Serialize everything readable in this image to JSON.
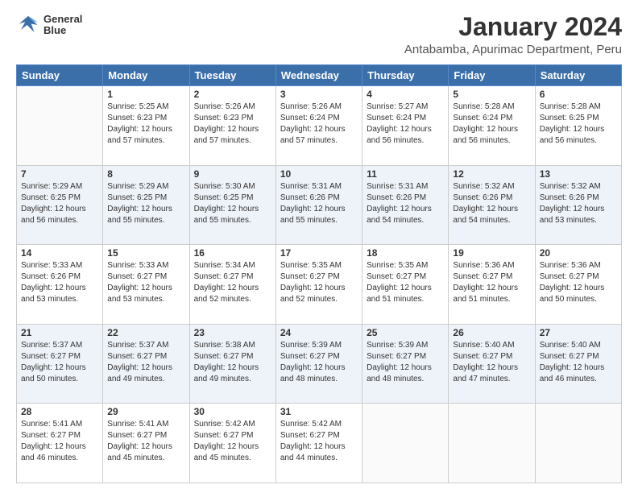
{
  "logo": {
    "line1": "General",
    "line2": "Blue"
  },
  "title": "January 2024",
  "subtitle": "Antabamba, Apurimac Department, Peru",
  "headers": [
    "Sunday",
    "Monday",
    "Tuesday",
    "Wednesday",
    "Thursday",
    "Friday",
    "Saturday"
  ],
  "weeks": [
    [
      {
        "day": "",
        "sunrise": "",
        "sunset": "",
        "daylight": ""
      },
      {
        "day": "1",
        "sunrise": "Sunrise: 5:25 AM",
        "sunset": "Sunset: 6:23 PM",
        "daylight": "Daylight: 12 hours and 57 minutes."
      },
      {
        "day": "2",
        "sunrise": "Sunrise: 5:26 AM",
        "sunset": "Sunset: 6:23 PM",
        "daylight": "Daylight: 12 hours and 57 minutes."
      },
      {
        "day": "3",
        "sunrise": "Sunrise: 5:26 AM",
        "sunset": "Sunset: 6:24 PM",
        "daylight": "Daylight: 12 hours and 57 minutes."
      },
      {
        "day": "4",
        "sunrise": "Sunrise: 5:27 AM",
        "sunset": "Sunset: 6:24 PM",
        "daylight": "Daylight: 12 hours and 56 minutes."
      },
      {
        "day": "5",
        "sunrise": "Sunrise: 5:28 AM",
        "sunset": "Sunset: 6:24 PM",
        "daylight": "Daylight: 12 hours and 56 minutes."
      },
      {
        "day": "6",
        "sunrise": "Sunrise: 5:28 AM",
        "sunset": "Sunset: 6:25 PM",
        "daylight": "Daylight: 12 hours and 56 minutes."
      }
    ],
    [
      {
        "day": "7",
        "sunrise": "Sunrise: 5:29 AM",
        "sunset": "Sunset: 6:25 PM",
        "daylight": "Daylight: 12 hours and 56 minutes."
      },
      {
        "day": "8",
        "sunrise": "Sunrise: 5:29 AM",
        "sunset": "Sunset: 6:25 PM",
        "daylight": "Daylight: 12 hours and 55 minutes."
      },
      {
        "day": "9",
        "sunrise": "Sunrise: 5:30 AM",
        "sunset": "Sunset: 6:25 PM",
        "daylight": "Daylight: 12 hours and 55 minutes."
      },
      {
        "day": "10",
        "sunrise": "Sunrise: 5:31 AM",
        "sunset": "Sunset: 6:26 PM",
        "daylight": "Daylight: 12 hours and 55 minutes."
      },
      {
        "day": "11",
        "sunrise": "Sunrise: 5:31 AM",
        "sunset": "Sunset: 6:26 PM",
        "daylight": "Daylight: 12 hours and 54 minutes."
      },
      {
        "day": "12",
        "sunrise": "Sunrise: 5:32 AM",
        "sunset": "Sunset: 6:26 PM",
        "daylight": "Daylight: 12 hours and 54 minutes."
      },
      {
        "day": "13",
        "sunrise": "Sunrise: 5:32 AM",
        "sunset": "Sunset: 6:26 PM",
        "daylight": "Daylight: 12 hours and 53 minutes."
      }
    ],
    [
      {
        "day": "14",
        "sunrise": "Sunrise: 5:33 AM",
        "sunset": "Sunset: 6:26 PM",
        "daylight": "Daylight: 12 hours and 53 minutes."
      },
      {
        "day": "15",
        "sunrise": "Sunrise: 5:33 AM",
        "sunset": "Sunset: 6:27 PM",
        "daylight": "Daylight: 12 hours and 53 minutes."
      },
      {
        "day": "16",
        "sunrise": "Sunrise: 5:34 AM",
        "sunset": "Sunset: 6:27 PM",
        "daylight": "Daylight: 12 hours and 52 minutes."
      },
      {
        "day": "17",
        "sunrise": "Sunrise: 5:35 AM",
        "sunset": "Sunset: 6:27 PM",
        "daylight": "Daylight: 12 hours and 52 minutes."
      },
      {
        "day": "18",
        "sunrise": "Sunrise: 5:35 AM",
        "sunset": "Sunset: 6:27 PM",
        "daylight": "Daylight: 12 hours and 51 minutes."
      },
      {
        "day": "19",
        "sunrise": "Sunrise: 5:36 AM",
        "sunset": "Sunset: 6:27 PM",
        "daylight": "Daylight: 12 hours and 51 minutes."
      },
      {
        "day": "20",
        "sunrise": "Sunrise: 5:36 AM",
        "sunset": "Sunset: 6:27 PM",
        "daylight": "Daylight: 12 hours and 50 minutes."
      }
    ],
    [
      {
        "day": "21",
        "sunrise": "Sunrise: 5:37 AM",
        "sunset": "Sunset: 6:27 PM",
        "daylight": "Daylight: 12 hours and 50 minutes."
      },
      {
        "day": "22",
        "sunrise": "Sunrise: 5:37 AM",
        "sunset": "Sunset: 6:27 PM",
        "daylight": "Daylight: 12 hours and 49 minutes."
      },
      {
        "day": "23",
        "sunrise": "Sunrise: 5:38 AM",
        "sunset": "Sunset: 6:27 PM",
        "daylight": "Daylight: 12 hours and 49 minutes."
      },
      {
        "day": "24",
        "sunrise": "Sunrise: 5:39 AM",
        "sunset": "Sunset: 6:27 PM",
        "daylight": "Daylight: 12 hours and 48 minutes."
      },
      {
        "day": "25",
        "sunrise": "Sunrise: 5:39 AM",
        "sunset": "Sunset: 6:27 PM",
        "daylight": "Daylight: 12 hours and 48 minutes."
      },
      {
        "day": "26",
        "sunrise": "Sunrise: 5:40 AM",
        "sunset": "Sunset: 6:27 PM",
        "daylight": "Daylight: 12 hours and 47 minutes."
      },
      {
        "day": "27",
        "sunrise": "Sunrise: 5:40 AM",
        "sunset": "Sunset: 6:27 PM",
        "daylight": "Daylight: 12 hours and 46 minutes."
      }
    ],
    [
      {
        "day": "28",
        "sunrise": "Sunrise: 5:41 AM",
        "sunset": "Sunset: 6:27 PM",
        "daylight": "Daylight: 12 hours and 46 minutes."
      },
      {
        "day": "29",
        "sunrise": "Sunrise: 5:41 AM",
        "sunset": "Sunset: 6:27 PM",
        "daylight": "Daylight: 12 hours and 45 minutes."
      },
      {
        "day": "30",
        "sunrise": "Sunrise: 5:42 AM",
        "sunset": "Sunset: 6:27 PM",
        "daylight": "Daylight: 12 hours and 45 minutes."
      },
      {
        "day": "31",
        "sunrise": "Sunrise: 5:42 AM",
        "sunset": "Sunset: 6:27 PM",
        "daylight": "Daylight: 12 hours and 44 minutes."
      },
      {
        "day": "",
        "sunrise": "",
        "sunset": "",
        "daylight": ""
      },
      {
        "day": "",
        "sunrise": "",
        "sunset": "",
        "daylight": ""
      },
      {
        "day": "",
        "sunrise": "",
        "sunset": "",
        "daylight": ""
      }
    ]
  ]
}
